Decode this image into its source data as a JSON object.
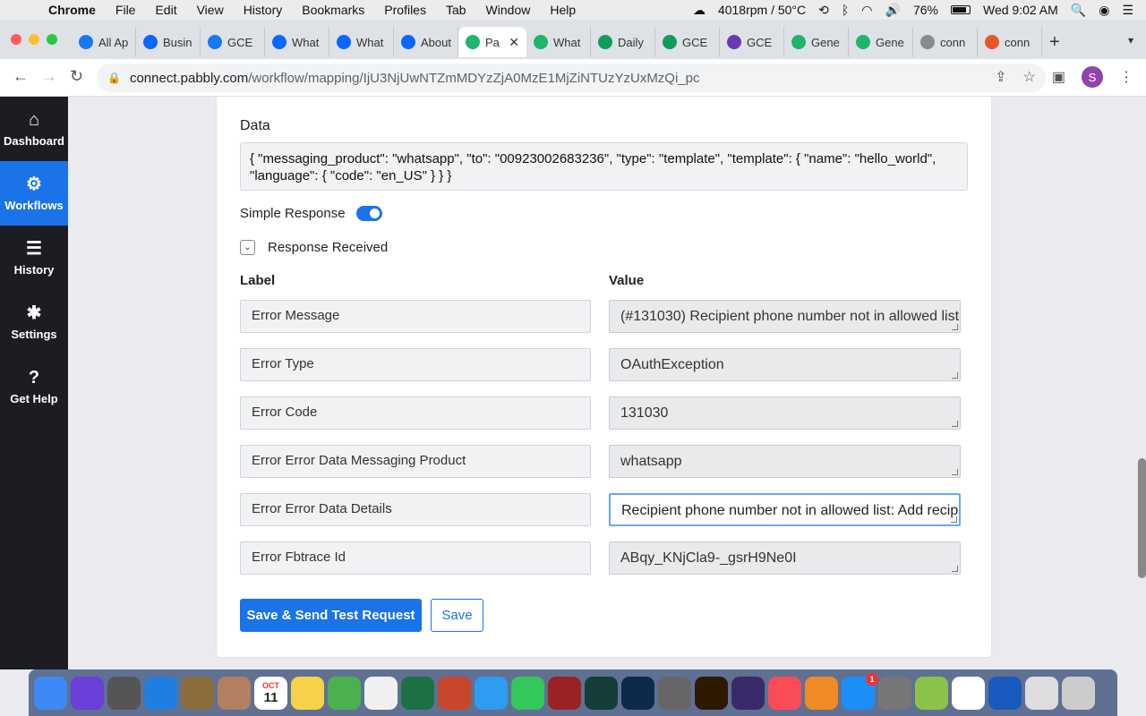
{
  "menubar": {
    "app_name": "Chrome",
    "menus": [
      "File",
      "Edit",
      "View",
      "History",
      "Bookmarks",
      "Profiles",
      "Tab",
      "Window",
      "Help"
    ],
    "status_fan": "4018rpm / 50°C",
    "battery": "76%",
    "clock": "Wed 9:02 AM"
  },
  "tabs": [
    {
      "label": "All Ap",
      "icon": "facebook-icon",
      "color": "#1877f2"
    },
    {
      "label": "Busin",
      "icon": "meta-icon",
      "color": "#0a66ff"
    },
    {
      "label": "GCE",
      "icon": "facebook-icon",
      "color": "#1877f2"
    },
    {
      "label": "What",
      "icon": "meta-icon",
      "color": "#0a66ff"
    },
    {
      "label": "What",
      "icon": "meta-icon",
      "color": "#0a66ff"
    },
    {
      "label": "About",
      "icon": "meta-icon",
      "color": "#0a66ff"
    },
    {
      "label": "Pa",
      "icon": "pabbly-icon",
      "color": "#1fb56a",
      "active": true
    },
    {
      "label": "What",
      "icon": "pabbly-icon",
      "color": "#1fb56a"
    },
    {
      "label": "Daily",
      "icon": "sheets-icon",
      "color": "#0f9d58"
    },
    {
      "label": "GCE",
      "icon": "sheets-icon",
      "color": "#0f9d58"
    },
    {
      "label": "GCE",
      "icon": "forms-icon",
      "color": "#673ab7"
    },
    {
      "label": "Gene",
      "icon": "pabbly-icon",
      "color": "#1fb56a"
    },
    {
      "label": "Gene",
      "icon": "pabbly-icon",
      "color": "#1fb56a"
    },
    {
      "label": "conn",
      "icon": "globe-icon",
      "color": "#8a8a8a"
    },
    {
      "label": "conn",
      "icon": "fire-icon",
      "color": "#e8562a"
    }
  ],
  "browser": {
    "url_host": "connect.pabbly.com",
    "url_path": "/workflow/mapping/IjU3NjUwNTZmMDYzZjA0MzE1MjZiNTUzYzUxMzQi_pc",
    "profile_initial": "S"
  },
  "sidebar": {
    "items": [
      {
        "label": "Dashboard",
        "icon": "home-icon"
      },
      {
        "label": "Workflows",
        "icon": "workflow-icon",
        "active": true
      },
      {
        "label": "History",
        "icon": "list-icon"
      },
      {
        "label": "Settings",
        "icon": "gear-icon"
      },
      {
        "label": "Get Help",
        "icon": "help-icon"
      }
    ]
  },
  "form": {
    "data_label": "Data",
    "data_value": "{ \"messaging_product\": \"whatsapp\", \"to\": \"00923002683236\", \"type\": \"template\", \"template\": { \"name\": \"hello_world\", \"language\": { \"code\": \"en_US\" } } }",
    "simple_response_label": "Simple Response",
    "simple_response_on": true,
    "response_received_label": "Response Received",
    "label_header": "Label",
    "value_header": "Value",
    "rows": [
      {
        "label": "Error Message",
        "value": "(#131030) Recipient phone number not in allowed list"
      },
      {
        "label": "Error Type",
        "value": "OAuthException"
      },
      {
        "label": "Error Code",
        "value": "131030"
      },
      {
        "label": "Error Error Data Messaging Product",
        "value": "whatsapp"
      },
      {
        "label": "Error Error Data Details",
        "value": "Recipient phone number not in allowed list: Add recipient phone number to recipient list and try again."
      },
      {
        "label": "Error Fbtrace Id",
        "value": "ABqy_KNjCla9-_gsrH9Ne0I"
      }
    ],
    "save_send_label": "Save & Send Test Request",
    "save_label": "Save"
  },
  "dock": {
    "apps": [
      "Finder",
      "Siri",
      "Launchpad",
      "Safari",
      "Preview",
      "Contacts",
      "Calendar",
      "Notes",
      "Maps",
      "Photos",
      "Excel",
      "PowerPoint",
      "Messages",
      "FaceTime",
      "Photo Booth",
      "Audition",
      "Photoshop",
      "Screenshot",
      "Illustrator",
      "iMovie",
      "Music",
      "Books",
      "App Store",
      "System Preferences",
      "Android File Transfer",
      "Chrome",
      "Word",
      "Downloads",
      "Trash"
    ],
    "calendar_month": "OCT",
    "calendar_day": "11",
    "app_store_badge": "1"
  }
}
